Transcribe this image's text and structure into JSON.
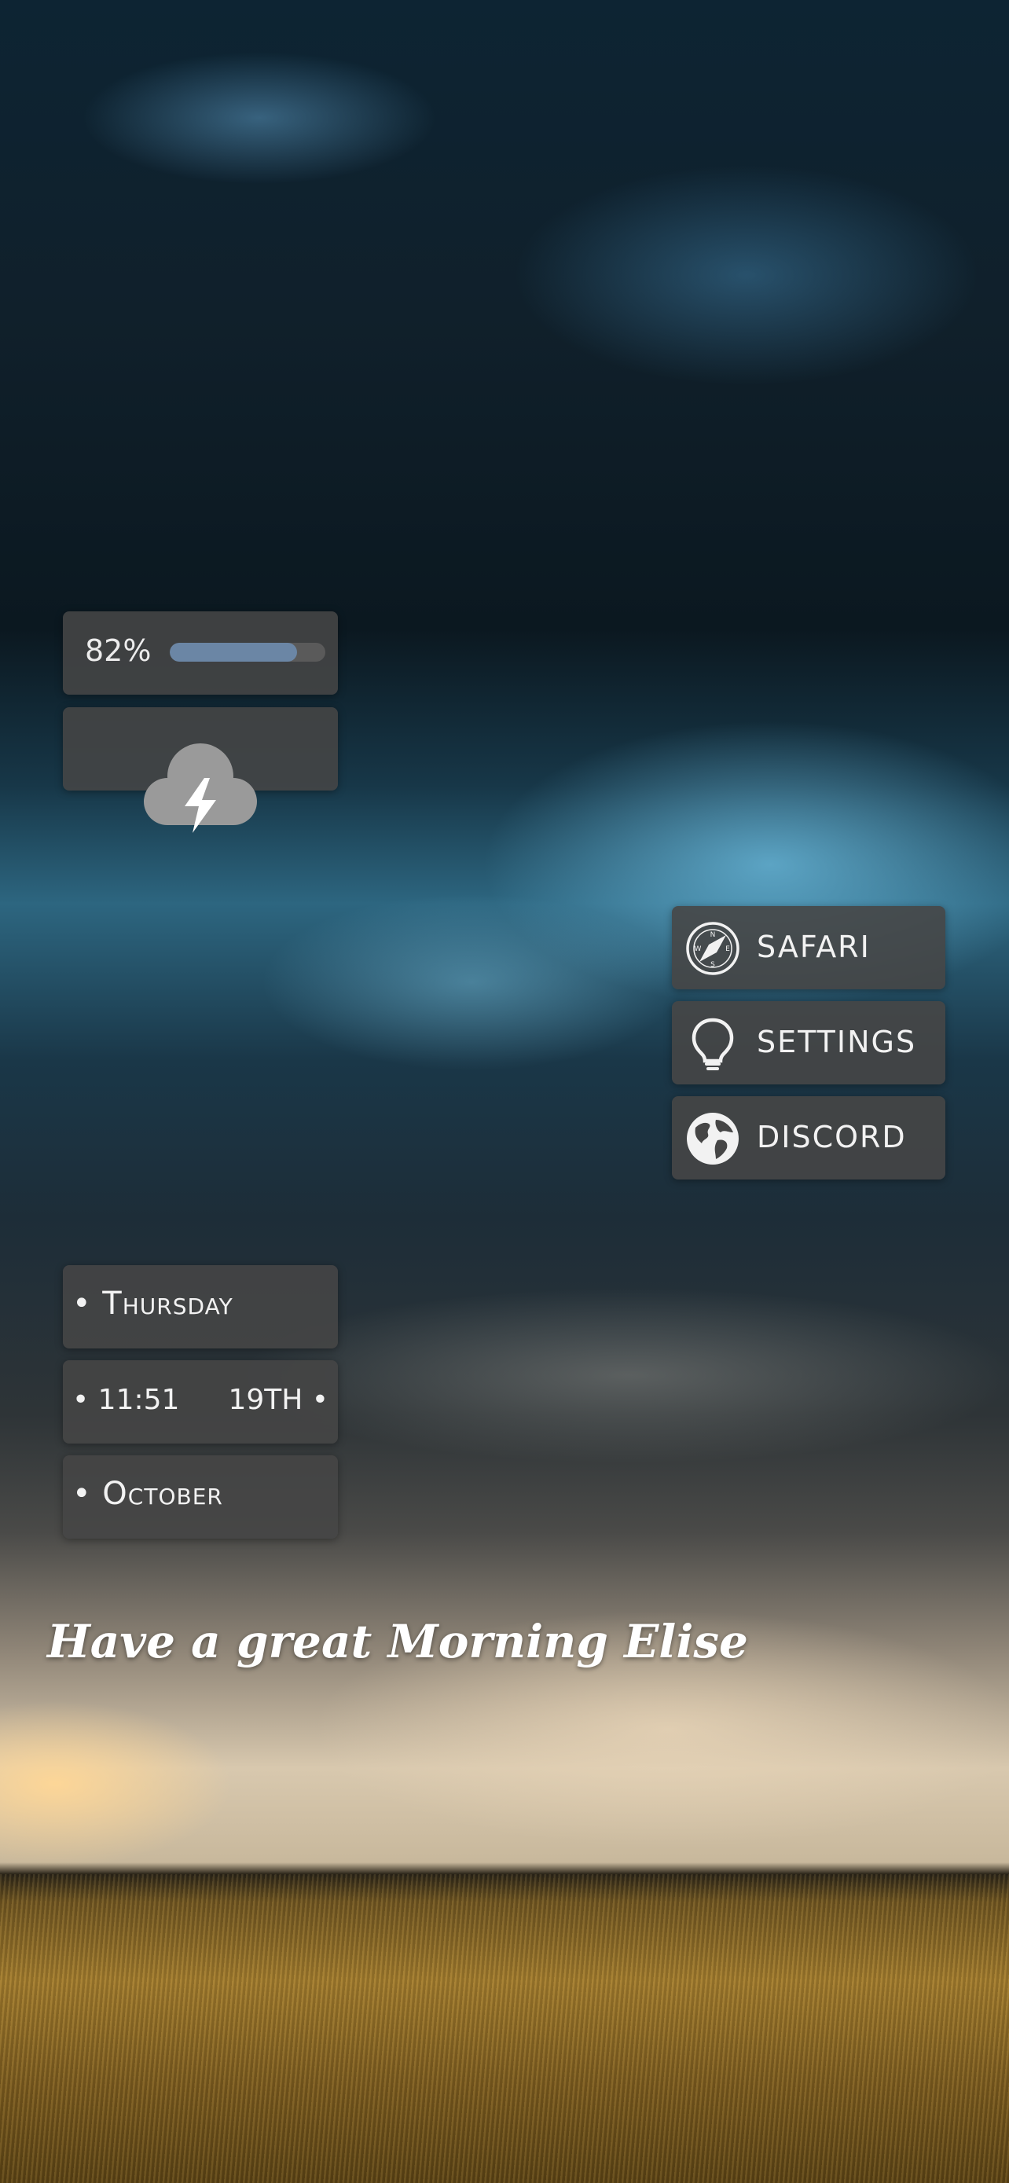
{
  "battery": {
    "label": "82%",
    "level": 0.82,
    "fill_color": "#6b86a5"
  },
  "weather": {
    "icon": "thunderstorm-cloud-icon"
  },
  "apps": [
    {
      "label": "SAFARI",
      "icon": "compass-icon"
    },
    {
      "label": "SETTINGS",
      "icon": "lightbulb-icon"
    },
    {
      "label": "DISCORD",
      "icon": "globe-icon"
    }
  ],
  "date": {
    "day": "• Thursday",
    "time": "• 11:51",
    "date": "19TH •",
    "month": "• October"
  },
  "greeting": "Have a great Morning Elise"
}
